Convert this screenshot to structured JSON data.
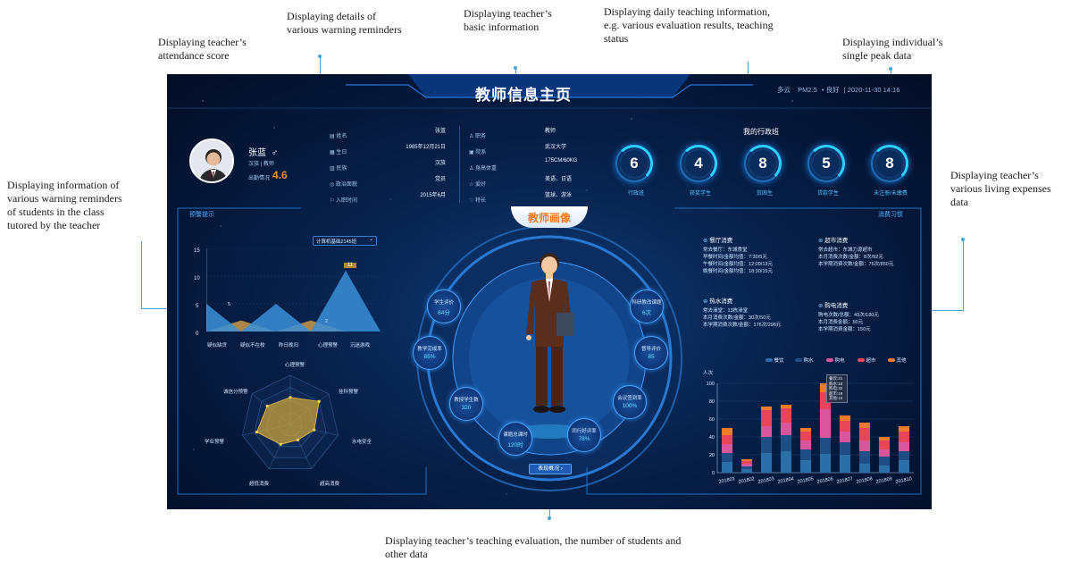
{
  "annotations": {
    "attendance": [
      "Displaying teacher’s",
      "attendance score"
    ],
    "warning_details": [
      "Displaying details of",
      "various warning reminders"
    ],
    "basic_info": [
      "Displaying teacher’s",
      "basic information"
    ],
    "daily_teaching": [
      "Displaying daily teaching information,",
      "e.g. various evaluation results, teaching",
      "status"
    ],
    "peak_data": [
      "Displaying individual’s",
      "single peak data"
    ],
    "student_warnings": [
      "Displaying information of",
      "various warning reminders",
      "of students in the class",
      "tutored by the teacher"
    ],
    "living_expenses": [
      "Displaying teacher’s",
      "various living expenses",
      "data"
    ],
    "evaluation": [
      "Displaying teacher’s teaching evaluation, the number of students and",
      "other data"
    ]
  },
  "dashboard": {
    "title": "教师信息主页",
    "status": {
      "weather": "多云",
      "pm": "PM2.5",
      "air": "• 良好",
      "datetime": "| 2020-11-30  14:16"
    },
    "profile": {
      "name": "张蓝",
      "sub": "汉族  | 教师",
      "attendance_label": "出勤情况",
      "attendance_score": "4.6"
    },
    "info_left": [
      {
        "label": "姓名",
        "value": "张蓝"
      },
      {
        "label": "生日",
        "value": "1985年12月21日"
      },
      {
        "label": "民族",
        "value": "汉族"
      },
      {
        "label": "政治面貌",
        "value": "党员"
      },
      {
        "label": "入职时间",
        "value": "2015年6月"
      }
    ],
    "info_right": [
      {
        "label": "职务",
        "value": "教师"
      },
      {
        "label": "院系",
        "value": "武汉大学"
      },
      {
        "label": "身高体重",
        "value": "175CM/60KG"
      },
      {
        "label": "爱好",
        "value": "美语、日语"
      },
      {
        "label": "特长",
        "value": "篮球、游泳"
      }
    ],
    "admin_class": {
      "title": "我的行政班",
      "rings": [
        {
          "value": "6",
          "label": "行政班"
        },
        {
          "value": "4",
          "label": "获奖学生"
        },
        {
          "value": "8",
          "label": "贫困生"
        },
        {
          "value": "5",
          "label": "贷款学生"
        },
        {
          "value": "8",
          "label": "未注册/未缴费"
        }
      ]
    },
    "warning": {
      "title": "预警提示",
      "select": "计算机基础2145班",
      "y_ticks": [
        "15",
        "10",
        "5",
        "0"
      ],
      "categories": [
        "疑似缺贷",
        "疑似不在校",
        "昨日晚归",
        "心理预警",
        "沉迷游戏"
      ],
      "peaks": [
        "5",
        "2",
        "11"
      ],
      "radar_labels": [
        "心理预警",
        "挂科预警",
        "水电安全",
        "超高消费",
        "超低消费",
        "学业预警",
        "诚信分预警"
      ]
    },
    "portrait": {
      "title": "教师画像",
      "button": "表现概况",
      "metrics": [
        {
          "label": "学生评价",
          "value": "84分"
        },
        {
          "label": "教学完成率",
          "value": "85%"
        },
        {
          "label": "教授学生数",
          "value": "320"
        },
        {
          "label": "课题总课时",
          "value": "120时"
        },
        {
          "label": "同行好评率",
          "value": "78%"
        },
        {
          "label": "会议签到率",
          "value": "100%"
        },
        {
          "label": "督导评价",
          "value": "85"
        },
        {
          "label": "科研教改课题",
          "value": "6次"
        }
      ]
    },
    "consumption": {
      "title": "消费习惯",
      "canteen": {
        "title": "餐厅消费",
        "lines": [
          "常去餐厅：东城食堂",
          "早餐时间/金额均值：7:30/5元",
          "午餐时间/金额均值：12:00/13元",
          "晚餐时间/金额均值：18:30/15元"
        ]
      },
      "market": {
        "title": "超市消费",
        "lines": [
          "常去超市：东城力源超市",
          "本月消费次数/金额：8次/92元",
          "本学期消费次数/金额：76次/850元"
        ]
      },
      "water": {
        "title": "热水消费",
        "lines": [
          "常去澡堂：13栋澡堂",
          "本月消费次数/金额：30次/50元",
          "本学期消费次数/金额：176次/296元"
        ]
      },
      "power": {
        "title": "购电消费",
        "lines": [
          "购电次数/总额：49次/180元",
          "本月消费金额：50元",
          "本学期消费金额：150元"
        ]
      },
      "legend": [
        "餐饮",
        "购水",
        "购电",
        "超市",
        "其他"
      ],
      "tooltip": [
        "餐饮:21",
        "购水:18",
        "购电:32",
        "超市:19",
        "其他:10"
      ],
      "ylabel": "人次"
    }
  },
  "chart_data": {
    "type": "bar",
    "ylabel": "人次",
    "ylim": [
      0,
      100
    ],
    "y_ticks": [
      0,
      20,
      40,
      60,
      80,
      100
    ],
    "categories": [
      "201801",
      "201802",
      "201803",
      "201804",
      "201805",
      "201806",
      "201807",
      "201808",
      "201809",
      "201810"
    ],
    "series": [
      {
        "name": "餐饮",
        "color": "#2a6fa8",
        "values": [
          12,
          4,
          22,
          24,
          14,
          21,
          20,
          10,
          8,
          14
        ]
      },
      {
        "name": "购水",
        "color": "#1f4d86",
        "values": [
          10,
          3,
          18,
          18,
          12,
          18,
          14,
          14,
          10,
          10
        ]
      },
      {
        "name": "购电",
        "color": "#d9559c",
        "values": [
          10,
          3,
          12,
          14,
          10,
          32,
          12,
          12,
          8,
          10
        ]
      },
      {
        "name": "超市",
        "color": "#e8455a",
        "values": [
          10,
          3,
          18,
          16,
          10,
          19,
          12,
          14,
          10,
          12
        ]
      },
      {
        "name": "其他",
        "color": "#ef7a2a",
        "values": [
          8,
          2,
          4,
          4,
          4,
          10,
          6,
          6,
          4,
          6
        ]
      }
    ]
  },
  "warning_chart": {
    "type": "area",
    "ylim": [
      0,
      15
    ],
    "series": [
      {
        "color": "#3a8fd8",
        "values": [
          5,
          0,
          5,
          0,
          11,
          0
        ]
      },
      {
        "color": "#c89a4a",
        "values": [
          0,
          2,
          0,
          2,
          0,
          0
        ]
      }
    ]
  },
  "radar": {
    "values": [
      0.55,
      0.75,
      0.5,
      0.35,
      0.45,
      0.7,
      0.6
    ]
  }
}
